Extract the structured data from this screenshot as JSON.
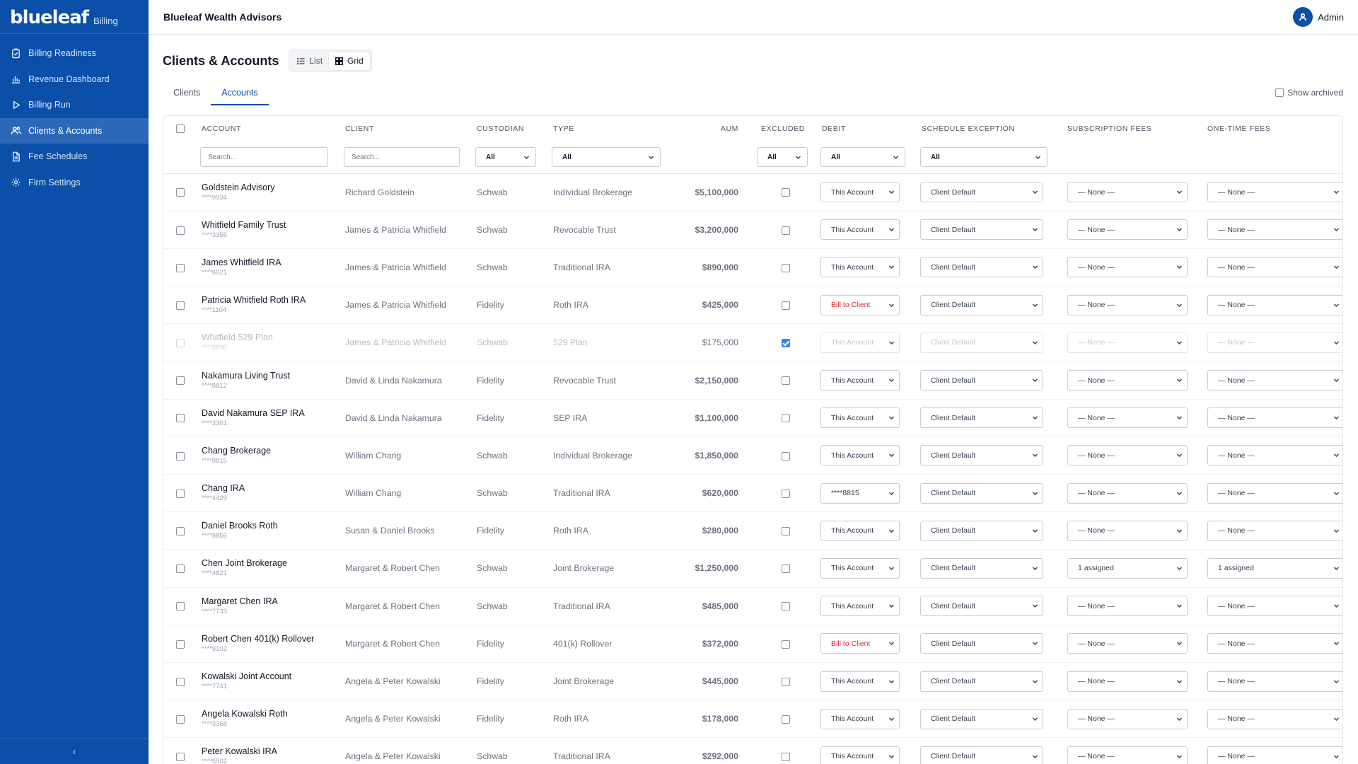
{
  "brand": {
    "logo": "blueleaf",
    "product": "Billing"
  },
  "nav": [
    {
      "label": "Billing Readiness",
      "icon": "clipboard-check-icon",
      "active": false
    },
    {
      "label": "Revenue Dashboard",
      "icon": "bar-chart-icon",
      "active": false
    },
    {
      "label": "Billing Run",
      "icon": "play-icon",
      "active": false
    },
    {
      "label": "Clients & Accounts",
      "icon": "users-icon",
      "active": true
    },
    {
      "label": "Fee Schedules",
      "icon": "document-icon",
      "active": false
    },
    {
      "label": "Firm Settings",
      "icon": "gear-icon",
      "active": false
    }
  ],
  "sidebar_collapse": "‹",
  "header": {
    "firm_name": "Blueleaf Wealth Advisors",
    "user": "Admin"
  },
  "page": {
    "title": "Clients & Accounts",
    "view_list": "List",
    "view_grid": "Grid",
    "active_view": "Grid"
  },
  "tabs": [
    {
      "label": "Clients",
      "active": false
    },
    {
      "label": "Accounts",
      "active": true
    }
  ],
  "show_archived": "Show archived",
  "columns": {
    "account": "ACCOUNT",
    "client": "CLIENT",
    "custodian": "CUSTODIAN",
    "type": "TYPE",
    "aum": "AUM",
    "excluded": "EXCLUDED",
    "debit": "DEBIT",
    "schedule_exception": "SCHEDULE EXCEPTION",
    "subscription_fees": "SUBSCRIPTION FEES",
    "one_time_fees": "ONE-TIME FEES"
  },
  "filters": {
    "account_placeholder": "Search...",
    "client_placeholder": "Search...",
    "custodian": "All",
    "type": "All",
    "excluded": "All",
    "debit": "All",
    "schedule_exception": "All"
  },
  "rows": [
    {
      "name": "Goldstein Advisory",
      "number": "****9934",
      "client": "Richard Goldstein",
      "custodian": "Schwab",
      "type": "Individual Brokerage",
      "aum": "$5,100,000",
      "excluded": false,
      "debit": "This Account",
      "schedule": "Client Default",
      "subscription": "— None —",
      "one_time": "— None —"
    },
    {
      "name": "Whitfield Family Trust",
      "number": "****3355",
      "client": "James & Patricia Whitfield",
      "custodian": "Schwab",
      "type": "Revocable Trust",
      "aum": "$3,200,000",
      "excluded": false,
      "debit": "This Account",
      "schedule": "Client Default",
      "subscription": "— None —",
      "one_time": "— None —"
    },
    {
      "name": "James Whitfield IRA",
      "number": "****6621",
      "client": "James & Patricia Whitfield",
      "custodian": "Schwab",
      "type": "Traditional IRA",
      "aum": "$890,000",
      "excluded": false,
      "debit": "This Account",
      "schedule": "Client Default",
      "subscription": "— None —",
      "one_time": "— None —"
    },
    {
      "name": "Patricia Whitfield Roth IRA",
      "number": "****1104",
      "client": "James & Patricia Whitfield",
      "custodian": "Fidelity",
      "type": "Roth IRA",
      "aum": "$425,000",
      "excluded": false,
      "debit": "Bill to Client",
      "schedule": "Client Default",
      "subscription": "— None —",
      "one_time": "— None —"
    },
    {
      "name": "Whitfield 529 Plan",
      "number": "****8890",
      "client": "James & Patricia Whitfield",
      "custodian": "Schwab",
      "type": "529 Plan",
      "aum": "$175,000",
      "excluded": true,
      "debit": "This Account",
      "schedule": "Client Default",
      "subscription": "— None —",
      "one_time": "— None —"
    },
    {
      "name": "Nakamura Living Trust",
      "number": "****8812",
      "client": "David & Linda Nakamura",
      "custodian": "Fidelity",
      "type": "Revocable Trust",
      "aum": "$2,150,000",
      "excluded": false,
      "debit": "This Account",
      "schedule": "Client Default",
      "subscription": "— None —",
      "one_time": "— None —"
    },
    {
      "name": "David Nakamura SEP IRA",
      "number": "****3301",
      "client": "David & Linda Nakamura",
      "custodian": "Fidelity",
      "type": "SEP IRA",
      "aum": "$1,100,000",
      "excluded": false,
      "debit": "This Account",
      "schedule": "Client Default",
      "subscription": "— None —",
      "one_time": "— None —"
    },
    {
      "name": "Chang Brokerage",
      "number": "****8815",
      "client": "William Chang",
      "custodian": "Schwab",
      "type": "Individual Brokerage",
      "aum": "$1,850,000",
      "excluded": false,
      "debit": "This Account",
      "schedule": "Client Default",
      "subscription": "— None —",
      "one_time": "— None —"
    },
    {
      "name": "Chang IRA",
      "number": "****4429",
      "client": "William Chang",
      "custodian": "Schwab",
      "type": "Traditional IRA",
      "aum": "$620,000",
      "excluded": false,
      "debit": "****8815",
      "schedule": "Client Default",
      "subscription": "— None —",
      "one_time": "— None —"
    },
    {
      "name": "Daniel Brooks Roth",
      "number": "****8856",
      "client": "Susan & Daniel Brooks",
      "custodian": "Fidelity",
      "type": "Roth IRA",
      "aum": "$280,000",
      "excluded": false,
      "debit": "This Account",
      "schedule": "Client Default",
      "subscription": "— None —",
      "one_time": "— None —"
    },
    {
      "name": "Chen Joint Brokerage",
      "number": "****4821",
      "client": "Margaret & Robert Chen",
      "custodian": "Schwab",
      "type": "Joint Brokerage",
      "aum": "$1,250,000",
      "excluded": false,
      "debit": "This Account",
      "schedule": "Client Default",
      "subscription": "1 assigned",
      "one_time": "1 assigned"
    },
    {
      "name": "Margaret Chen IRA",
      "number": "****7733",
      "client": "Margaret & Robert Chen",
      "custodian": "Schwab",
      "type": "Traditional IRA",
      "aum": "$485,000",
      "excluded": false,
      "debit": "This Account",
      "schedule": "Client Default",
      "subscription": "— None —",
      "one_time": "— None —"
    },
    {
      "name": "Robert Chen 401(k) Rollover",
      "number": "****9102",
      "client": "Margaret & Robert Chen",
      "custodian": "Fidelity",
      "type": "401(k) Rollover",
      "aum": "$372,000",
      "excluded": false,
      "debit": "Bill to Client",
      "schedule": "Client Default",
      "subscription": "— None —",
      "one_time": "— None —"
    },
    {
      "name": "Kowalski Joint Account",
      "number": "****7741",
      "client": "Angela & Peter Kowalski",
      "custodian": "Fidelity",
      "type": "Joint Brokerage",
      "aum": "$445,000",
      "excluded": false,
      "debit": "This Account",
      "schedule": "Client Default",
      "subscription": "— None —",
      "one_time": "— None —"
    },
    {
      "name": "Angela Kowalski Roth",
      "number": "****3368",
      "client": "Angela & Peter Kowalski",
      "custodian": "Fidelity",
      "type": "Roth IRA",
      "aum": "$178,000",
      "excluded": false,
      "debit": "This Account",
      "schedule": "Client Default",
      "subscription": "— None —",
      "one_time": "— None —"
    },
    {
      "name": "Peter Kowalski IRA",
      "number": "****5502",
      "client": "Angela & Peter Kowalski",
      "custodian": "Schwab",
      "type": "Traditional IRA",
      "aum": "$292,000",
      "excluded": false,
      "debit": "This Account",
      "schedule": "Client Default",
      "subscription": "— None —",
      "one_time": "— None —"
    }
  ],
  "colors": {
    "sidebar": "#0b4fa8",
    "sidebar_active": "#2d67b8",
    "accent": "#0b4fa8",
    "warning_text": "#dc2626",
    "checkbox_checked": "#3b82f6"
  }
}
